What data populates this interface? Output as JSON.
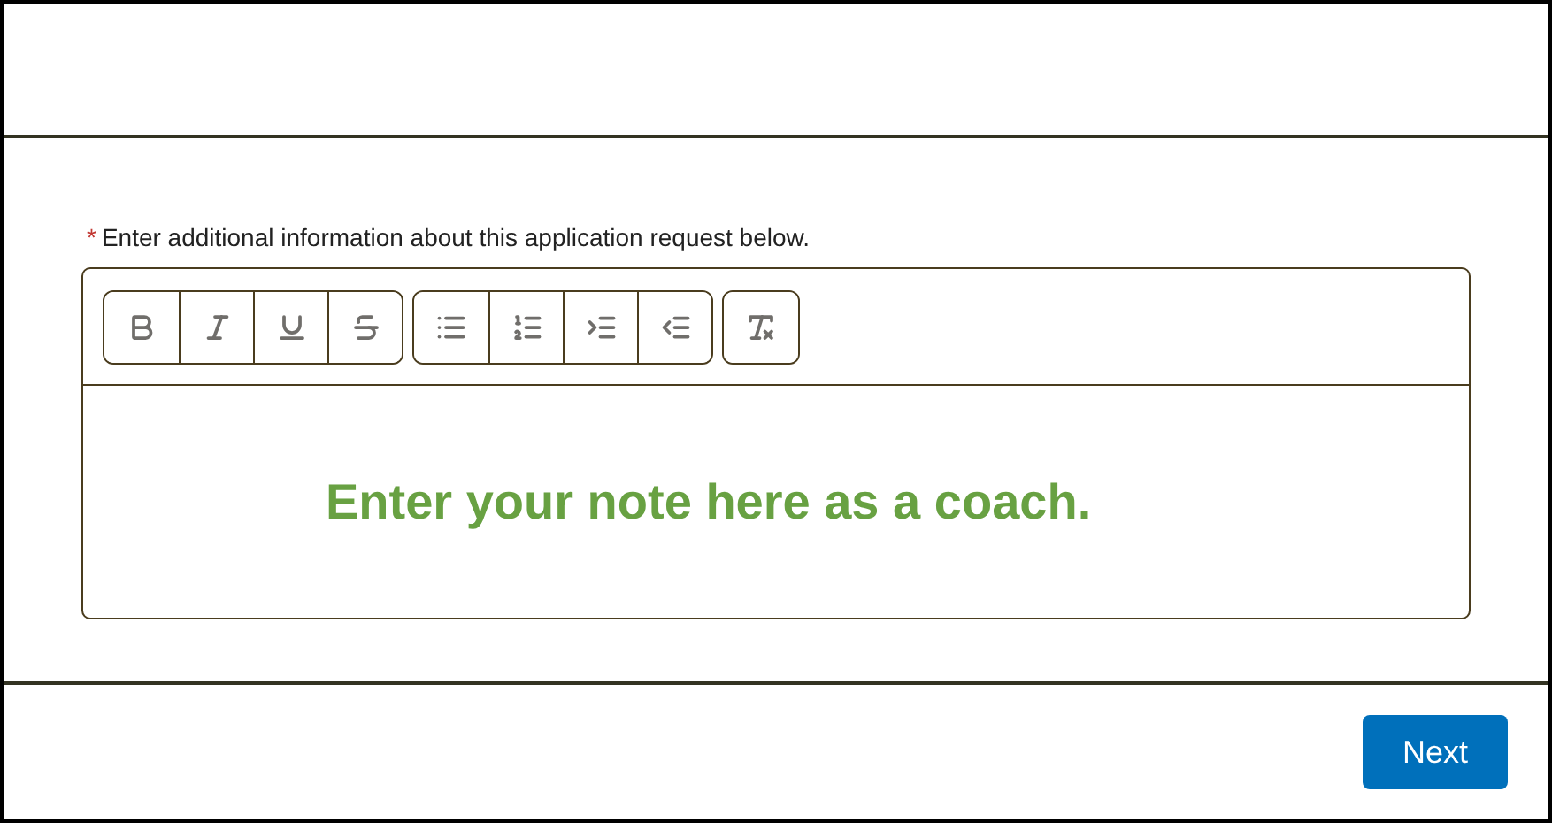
{
  "field": {
    "required_mark": "*",
    "label": "Enter additional information about this application request below."
  },
  "editor": {
    "value": "Enter your note here as a coach."
  },
  "footer": {
    "buttons": [
      "Next"
    ]
  }
}
